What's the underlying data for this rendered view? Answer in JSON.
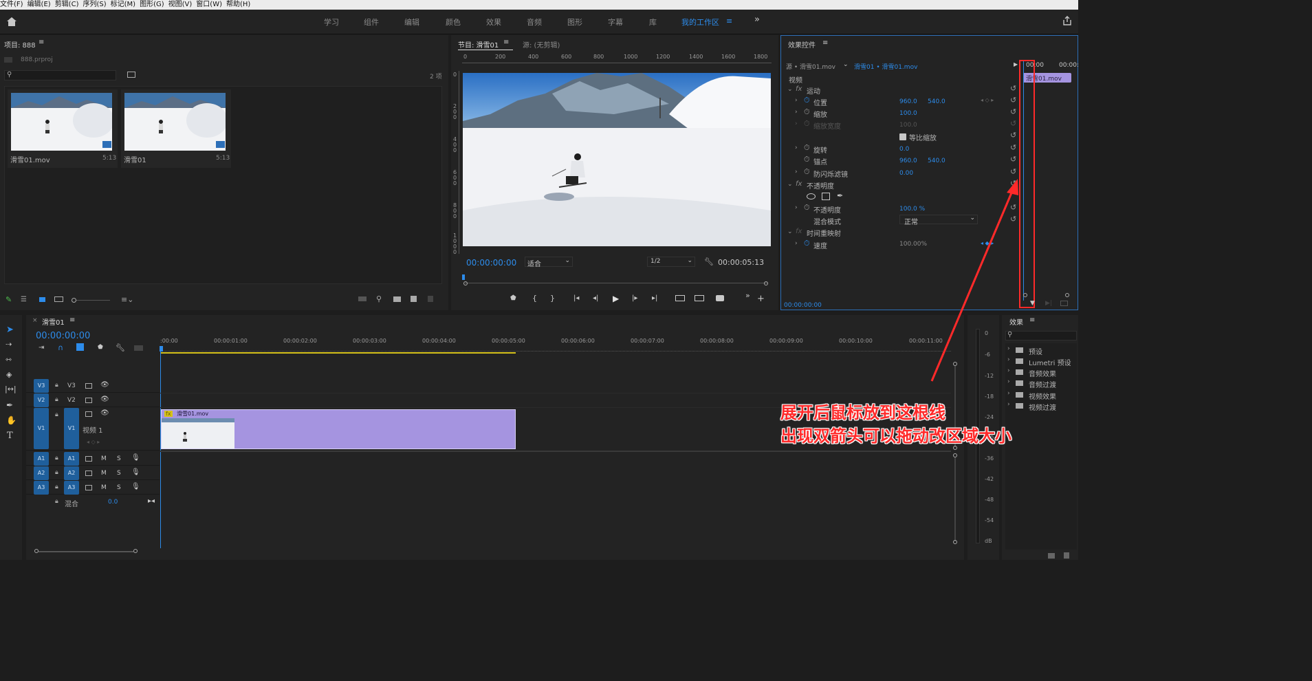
{
  "menu": [
    "文件(F)",
    "编辑(E)",
    "剪辑(C)",
    "序列(S)",
    "标记(M)",
    "图形(G)",
    "视图(V)",
    "窗口(W)",
    "帮助(H)"
  ],
  "workspaces": [
    "学习",
    "组件",
    "编辑",
    "颜色",
    "效果",
    "音频",
    "图形",
    "字幕",
    "库"
  ],
  "active_workspace": "我的工作区",
  "project": {
    "title": "项目: 888",
    "file": "888.prproj",
    "count": "2 项",
    "items": [
      {
        "name": "滑雪01.mov",
        "duration": "5:13"
      },
      {
        "name": "滑雪01",
        "duration": "5:13"
      }
    ]
  },
  "program": {
    "tab": "节目: 滑雪01",
    "source_tab": "源: (无剪辑)",
    "timecode": "00:00:00:00",
    "fit": "适合",
    "resolution": "1/2",
    "duration": "00:00:05:13",
    "ruler": [
      "0",
      "200",
      "400",
      "600",
      "800",
      "1000",
      "1200",
      "1400",
      "1600",
      "1800"
    ],
    "vruler": [
      "0",
      "2 0 0",
      "4 0 0",
      "6 0 0",
      "8 0 0",
      "1 0 0 0"
    ]
  },
  "effects_controls": {
    "title": "效果控件",
    "source": "源 • 滑雪01.mov",
    "sequence": "滑雪01 • 滑雪01.mov",
    "section": "视频",
    "clip_label": "滑雪01.mov",
    "time_left": "00:00",
    "time_right": "00:00:",
    "timecode": "00:00:00:00",
    "motion": "运动",
    "position": {
      "label": "位置",
      "x": "960.0",
      "y": "540.0"
    },
    "scale": {
      "label": "缩放",
      "value": "100.0"
    },
    "scale_width": {
      "label": "缩放宽度",
      "value": "100.0"
    },
    "uniform": "等比缩放",
    "rotation": {
      "label": "旋转",
      "value": "0.0"
    },
    "anchor": {
      "label": "锚点",
      "x": "960.0",
      "y": "540.0"
    },
    "flicker": {
      "label": "防闪烁滤镜",
      "value": "0.00"
    },
    "opacity_group": "不透明度",
    "opacity": {
      "label": "不透明度",
      "value": "100.0 %"
    },
    "blend": {
      "label": "混合模式",
      "value": "正常"
    },
    "time_remap": "时间重映射",
    "speed": {
      "label": "速度",
      "value": "100.00%"
    }
  },
  "timeline": {
    "tab": "滑雪01",
    "timecode": "00:00:00:00",
    "ruler": [
      ":00:00",
      "00:00:01:00",
      "00:00:02:00",
      "00:00:03:00",
      "00:00:04:00",
      "00:00:05:00",
      "00:00:06:00",
      "00:00:07:00",
      "00:00:08:00",
      "00:00:09:00",
      "00:00:10:00",
      "00:00:11:00"
    ],
    "video_tracks": [
      "V3",
      "V2",
      "V1"
    ],
    "audio_tracks": [
      "A1",
      "A2",
      "A3"
    ],
    "v1_name": "视频 1",
    "clip": "滑雪01.mov",
    "clip_fx": "fx",
    "mix_label": "混合",
    "mix_value": "0.0",
    "m": "M",
    "s": "S"
  },
  "meter": [
    "0",
    "-6",
    "-12",
    "-18",
    "-24",
    "-30",
    "-36",
    "-42",
    "-48",
    "-54",
    "dB"
  ],
  "effects_panel": {
    "title": "效果",
    "items": [
      "预设",
      "Lumetri 预设",
      "音频效果",
      "音频过渡",
      "视频效果",
      "视频过渡"
    ]
  },
  "annotation": {
    "line1": "展开后鼠标放到这根线",
    "line2": "出现双箭头可以拖动改区域大小"
  },
  "colors": {
    "accent": "#2d8ceb",
    "clip": "#a594e0",
    "annotation": "#ff2a2a",
    "track": "#1f5f9c"
  }
}
